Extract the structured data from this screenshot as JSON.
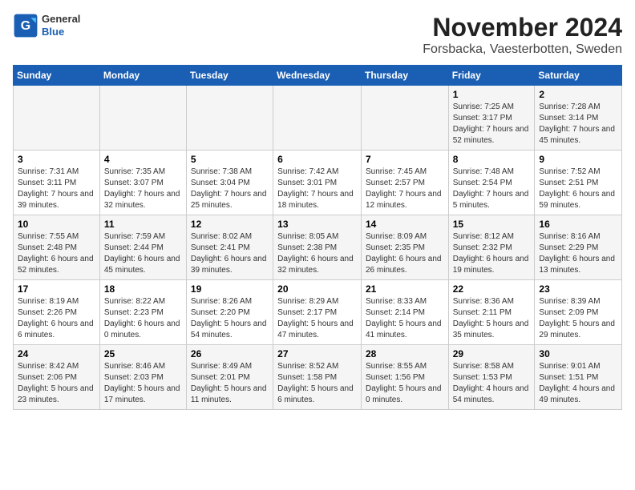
{
  "header": {
    "logo_general": "General",
    "logo_blue": "Blue",
    "title": "November 2024",
    "subtitle": "Forsbacka, Vaesterbotten, Sweden"
  },
  "calendar": {
    "days_of_week": [
      "Sunday",
      "Monday",
      "Tuesday",
      "Wednesday",
      "Thursday",
      "Friday",
      "Saturday"
    ],
    "weeks": [
      [
        {
          "day": "",
          "info": ""
        },
        {
          "day": "",
          "info": ""
        },
        {
          "day": "",
          "info": ""
        },
        {
          "day": "",
          "info": ""
        },
        {
          "day": "",
          "info": ""
        },
        {
          "day": "1",
          "info": "Sunrise: 7:25 AM\nSunset: 3:17 PM\nDaylight: 7 hours and 52 minutes."
        },
        {
          "day": "2",
          "info": "Sunrise: 7:28 AM\nSunset: 3:14 PM\nDaylight: 7 hours and 45 minutes."
        }
      ],
      [
        {
          "day": "3",
          "info": "Sunrise: 7:31 AM\nSunset: 3:11 PM\nDaylight: 7 hours and 39 minutes."
        },
        {
          "day": "4",
          "info": "Sunrise: 7:35 AM\nSunset: 3:07 PM\nDaylight: 7 hours and 32 minutes."
        },
        {
          "day": "5",
          "info": "Sunrise: 7:38 AM\nSunset: 3:04 PM\nDaylight: 7 hours and 25 minutes."
        },
        {
          "day": "6",
          "info": "Sunrise: 7:42 AM\nSunset: 3:01 PM\nDaylight: 7 hours and 18 minutes."
        },
        {
          "day": "7",
          "info": "Sunrise: 7:45 AM\nSunset: 2:57 PM\nDaylight: 7 hours and 12 minutes."
        },
        {
          "day": "8",
          "info": "Sunrise: 7:48 AM\nSunset: 2:54 PM\nDaylight: 7 hours and 5 minutes."
        },
        {
          "day": "9",
          "info": "Sunrise: 7:52 AM\nSunset: 2:51 PM\nDaylight: 6 hours and 59 minutes."
        }
      ],
      [
        {
          "day": "10",
          "info": "Sunrise: 7:55 AM\nSunset: 2:48 PM\nDaylight: 6 hours and 52 minutes."
        },
        {
          "day": "11",
          "info": "Sunrise: 7:59 AM\nSunset: 2:44 PM\nDaylight: 6 hours and 45 minutes."
        },
        {
          "day": "12",
          "info": "Sunrise: 8:02 AM\nSunset: 2:41 PM\nDaylight: 6 hours and 39 minutes."
        },
        {
          "day": "13",
          "info": "Sunrise: 8:05 AM\nSunset: 2:38 PM\nDaylight: 6 hours and 32 minutes."
        },
        {
          "day": "14",
          "info": "Sunrise: 8:09 AM\nSunset: 2:35 PM\nDaylight: 6 hours and 26 minutes."
        },
        {
          "day": "15",
          "info": "Sunrise: 8:12 AM\nSunset: 2:32 PM\nDaylight: 6 hours and 19 minutes."
        },
        {
          "day": "16",
          "info": "Sunrise: 8:16 AM\nSunset: 2:29 PM\nDaylight: 6 hours and 13 minutes."
        }
      ],
      [
        {
          "day": "17",
          "info": "Sunrise: 8:19 AM\nSunset: 2:26 PM\nDaylight: 6 hours and 6 minutes."
        },
        {
          "day": "18",
          "info": "Sunrise: 8:22 AM\nSunset: 2:23 PM\nDaylight: 6 hours and 0 minutes."
        },
        {
          "day": "19",
          "info": "Sunrise: 8:26 AM\nSunset: 2:20 PM\nDaylight: 5 hours and 54 minutes."
        },
        {
          "day": "20",
          "info": "Sunrise: 8:29 AM\nSunset: 2:17 PM\nDaylight: 5 hours and 47 minutes."
        },
        {
          "day": "21",
          "info": "Sunrise: 8:33 AM\nSunset: 2:14 PM\nDaylight: 5 hours and 41 minutes."
        },
        {
          "day": "22",
          "info": "Sunrise: 8:36 AM\nSunset: 2:11 PM\nDaylight: 5 hours and 35 minutes."
        },
        {
          "day": "23",
          "info": "Sunrise: 8:39 AM\nSunset: 2:09 PM\nDaylight: 5 hours and 29 minutes."
        }
      ],
      [
        {
          "day": "24",
          "info": "Sunrise: 8:42 AM\nSunset: 2:06 PM\nDaylight: 5 hours and 23 minutes."
        },
        {
          "day": "25",
          "info": "Sunrise: 8:46 AM\nSunset: 2:03 PM\nDaylight: 5 hours and 17 minutes."
        },
        {
          "day": "26",
          "info": "Sunrise: 8:49 AM\nSunset: 2:01 PM\nDaylight: 5 hours and 11 minutes."
        },
        {
          "day": "27",
          "info": "Sunrise: 8:52 AM\nSunset: 1:58 PM\nDaylight: 5 hours and 6 minutes."
        },
        {
          "day": "28",
          "info": "Sunrise: 8:55 AM\nSunset: 1:56 PM\nDaylight: 5 hours and 0 minutes."
        },
        {
          "day": "29",
          "info": "Sunrise: 8:58 AM\nSunset: 1:53 PM\nDaylight: 4 hours and 54 minutes."
        },
        {
          "day": "30",
          "info": "Sunrise: 9:01 AM\nSunset: 1:51 PM\nDaylight: 4 hours and 49 minutes."
        }
      ]
    ]
  }
}
